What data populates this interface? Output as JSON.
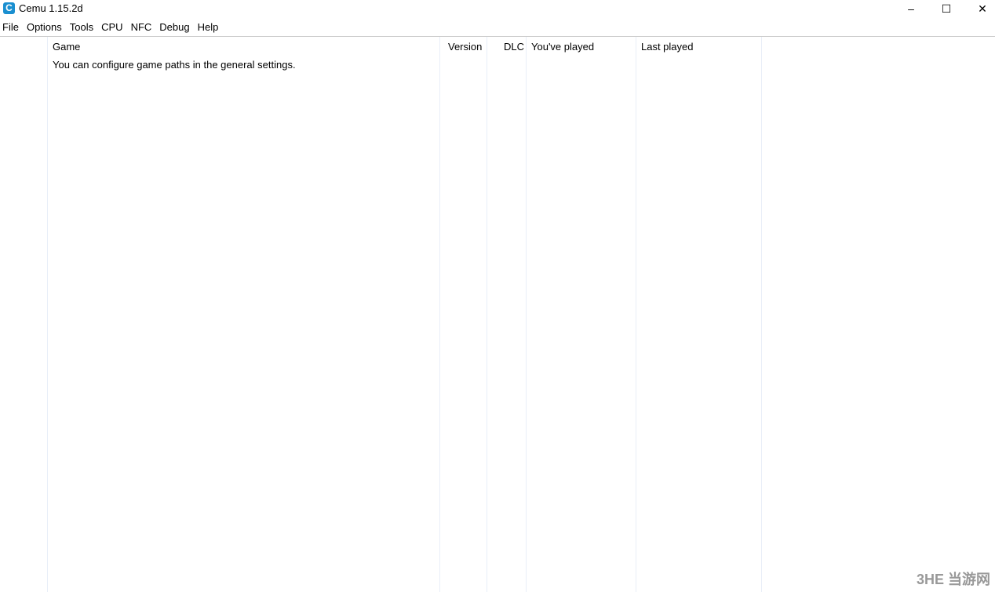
{
  "window": {
    "title": "Cemu 1.15.2d",
    "icon_letter": "C",
    "minimize": "–",
    "maximize": "☐",
    "close": "✕"
  },
  "menu": [
    "File",
    "Options",
    "Tools",
    "CPU",
    "NFC",
    "Debug",
    "Help"
  ],
  "columns": [
    "Game",
    "Version",
    "DLC",
    "You've played",
    "Last played"
  ],
  "message": "You can configure game paths in the general settings.",
  "watermark": "3HE 当游网"
}
